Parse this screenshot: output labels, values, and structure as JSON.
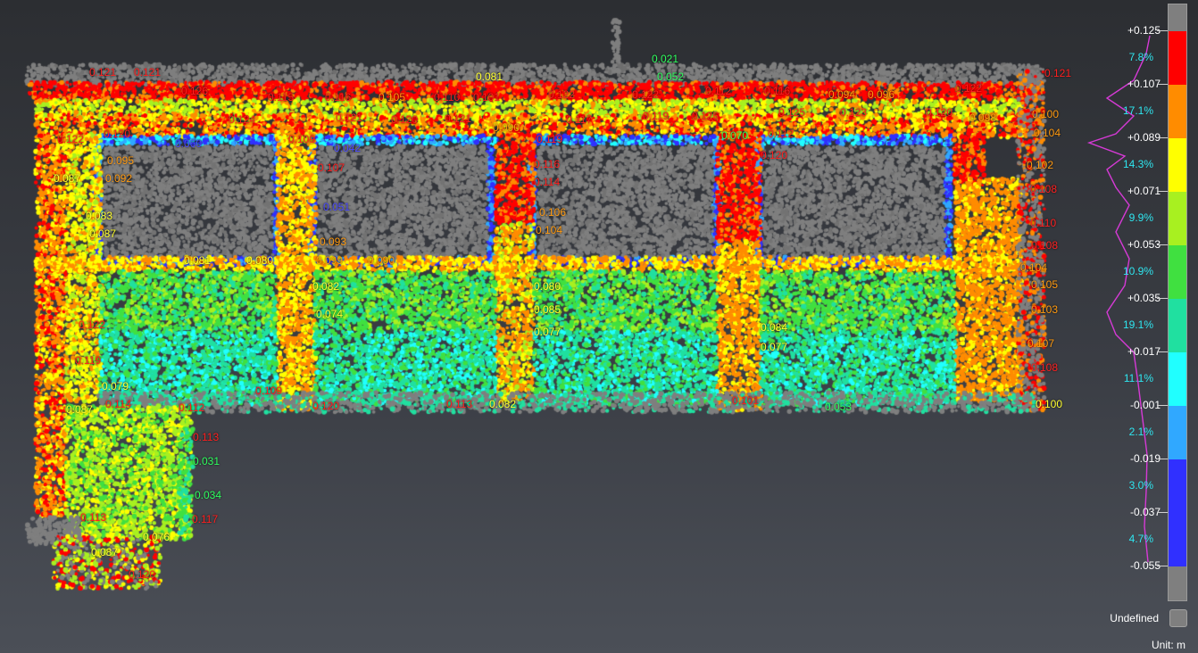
{
  "colors": {
    "undefined": "#7f7f7f",
    "histogram": "#d63ad6",
    "percent_text": "#2ee6f0",
    "scale": [
      "#ff0000",
      "#ff8c00",
      "#ffff00",
      "#a8f020",
      "#40e040",
      "#20e0a0",
      "#20ffff",
      "#30a8ff",
      "#3030ff"
    ]
  },
  "scale": {
    "values": [
      "+0.125",
      "+0.107",
      "+0.089",
      "+0.071",
      "+0.053",
      "+0.035",
      "+0.017",
      "-0.001",
      "-0.019",
      "-0.037",
      "-0.055"
    ],
    "percentages": [
      "7.8%",
      "17.1%",
      "14.3%",
      "9.9%",
      "10.9%",
      "19.1%",
      "11.1%",
      "2.1%",
      "3.0%",
      "4.7%"
    ],
    "undefined_label": "Undefined",
    "unit_label": "Unit: m"
  },
  "labels": [
    {
      "text": "0.021",
      "c": "g"
    },
    {
      "text": "0.052",
      "c": "g"
    },
    {
      "text": "0.081",
      "c": "y"
    },
    {
      "text": "0.121",
      "c": "r"
    },
    {
      "text": "0.121",
      "c": "r"
    },
    {
      "text": "0.121",
      "c": "r"
    },
    {
      "text": "0.126",
      "c": "r"
    },
    {
      "text": "0.115",
      "c": "r"
    },
    {
      "text": "0.116",
      "c": "r"
    },
    {
      "text": "0.105",
      "c": "o"
    },
    {
      "text": "0.110",
      "c": "r"
    },
    {
      "text": "0.101",
      "c": "r"
    },
    {
      "text": "0.122",
      "c": "r"
    },
    {
      "text": "0.122",
      "c": "r"
    },
    {
      "text": "0.112",
      "c": "r"
    },
    {
      "text": "0.116",
      "c": "r"
    },
    {
      "text": "0.094",
      "c": "o"
    },
    {
      "text": "0.096",
      "c": "o"
    },
    {
      "text": "0.122",
      "c": "r"
    },
    {
      "text": "0.124",
      "c": "r"
    },
    {
      "text": "0.121",
      "c": "r"
    },
    {
      "text": "0.120",
      "c": "r"
    },
    {
      "text": "0.121",
      "c": "r"
    },
    {
      "text": "0.117",
      "c": "r"
    },
    {
      "text": "0.119",
      "c": "r"
    },
    {
      "text": "0.125",
      "c": "r"
    },
    {
      "text": "0.125",
      "c": "r"
    },
    {
      "text": "0.123",
      "c": "r"
    },
    {
      "text": "0.120",
      "c": "r"
    },
    {
      "text": "0.098",
      "c": "o"
    },
    {
      "text": "0.100",
      "c": "o"
    },
    {
      "text": "0.104",
      "c": "o"
    },
    {
      "text": "0.122",
      "c": "r"
    },
    {
      "text": "0.120",
      "c": "r"
    },
    {
      "text": "0.060",
      "c": "b"
    },
    {
      "text": "0.109",
      "c": "r"
    },
    {
      "text": "0.042",
      "c": "b"
    },
    {
      "text": "0.090",
      "c": "o"
    },
    {
      "text": "0.119",
      "c": "r"
    },
    {
      "text": "0.070",
      "c": "g"
    },
    {
      "text": "0.112",
      "c": "r"
    },
    {
      "text": "0.095",
      "c": "o"
    },
    {
      "text": "0.087",
      "c": "y"
    },
    {
      "text": "0.092",
      "c": "o"
    },
    {
      "text": "0.083",
      "c": "y"
    },
    {
      "text": "0.087",
      "c": "y"
    },
    {
      "text": "0.081",
      "c": "y"
    },
    {
      "text": "0.080",
      "c": "y"
    },
    {
      "text": "0.099",
      "c": "o"
    },
    {
      "text": "0.090",
      "c": "o"
    },
    {
      "text": "0.107",
      "c": "r"
    },
    {
      "text": "0.051",
      "c": "b"
    },
    {
      "text": "0.093",
      "c": "o"
    },
    {
      "text": "0.116",
      "c": "r"
    },
    {
      "text": "0.114",
      "c": "r"
    },
    {
      "text": "0.106",
      "c": "o"
    },
    {
      "text": "0.104",
      "c": "o"
    },
    {
      "text": "0.120",
      "c": "r"
    },
    {
      "text": "0.102",
      "c": "o"
    },
    {
      "text": "0.108",
      "c": "r"
    },
    {
      "text": "0.110",
      "c": "r"
    },
    {
      "text": "0.108",
      "c": "r"
    },
    {
      "text": "0.104",
      "c": "o"
    },
    {
      "text": "0.105",
      "c": "o"
    },
    {
      "text": "0.103",
      "c": "o"
    },
    {
      "text": "0.107",
      "c": "o"
    },
    {
      "text": "0.108",
      "c": "r"
    },
    {
      "text": "0.100",
      "c": "y"
    },
    {
      "text": "0.082",
      "c": "y"
    },
    {
      "text": "0.074",
      "c": "y"
    },
    {
      "text": "0.080",
      "c": "y"
    },
    {
      "text": "0.085",
      "c": "y"
    },
    {
      "text": "0.077",
      "c": "y"
    },
    {
      "text": "0.084",
      "c": "y"
    },
    {
      "text": "0.077",
      "c": "y"
    },
    {
      "text": "0.122",
      "c": "r"
    },
    {
      "text": "0.119",
      "c": "r"
    },
    {
      "text": "0.079",
      "c": "y"
    },
    {
      "text": "0.114",
      "c": "r"
    },
    {
      "text": "0.109",
      "c": "r"
    },
    {
      "text": "0.120",
      "c": "r"
    },
    {
      "text": "0.113",
      "c": "r"
    },
    {
      "text": "0.082",
      "c": "y"
    },
    {
      "text": "0.101",
      "c": "r"
    },
    {
      "text": "0.053",
      "c": "g"
    },
    {
      "text": "0.087",
      "c": "y"
    },
    {
      "text": "0.112",
      "c": "r"
    },
    {
      "text": "0.113",
      "c": "r"
    },
    {
      "text": "0.031",
      "c": "g"
    },
    {
      "text": "0.034",
      "c": "g"
    },
    {
      "text": "0.117",
      "c": "r"
    },
    {
      "text": "0.113",
      "c": "r"
    },
    {
      "text": "0.076",
      "c": "y"
    },
    {
      "text": "0.087",
      "c": "y"
    },
    {
      "text": "0.120",
      "c": "r"
    }
  ]
}
